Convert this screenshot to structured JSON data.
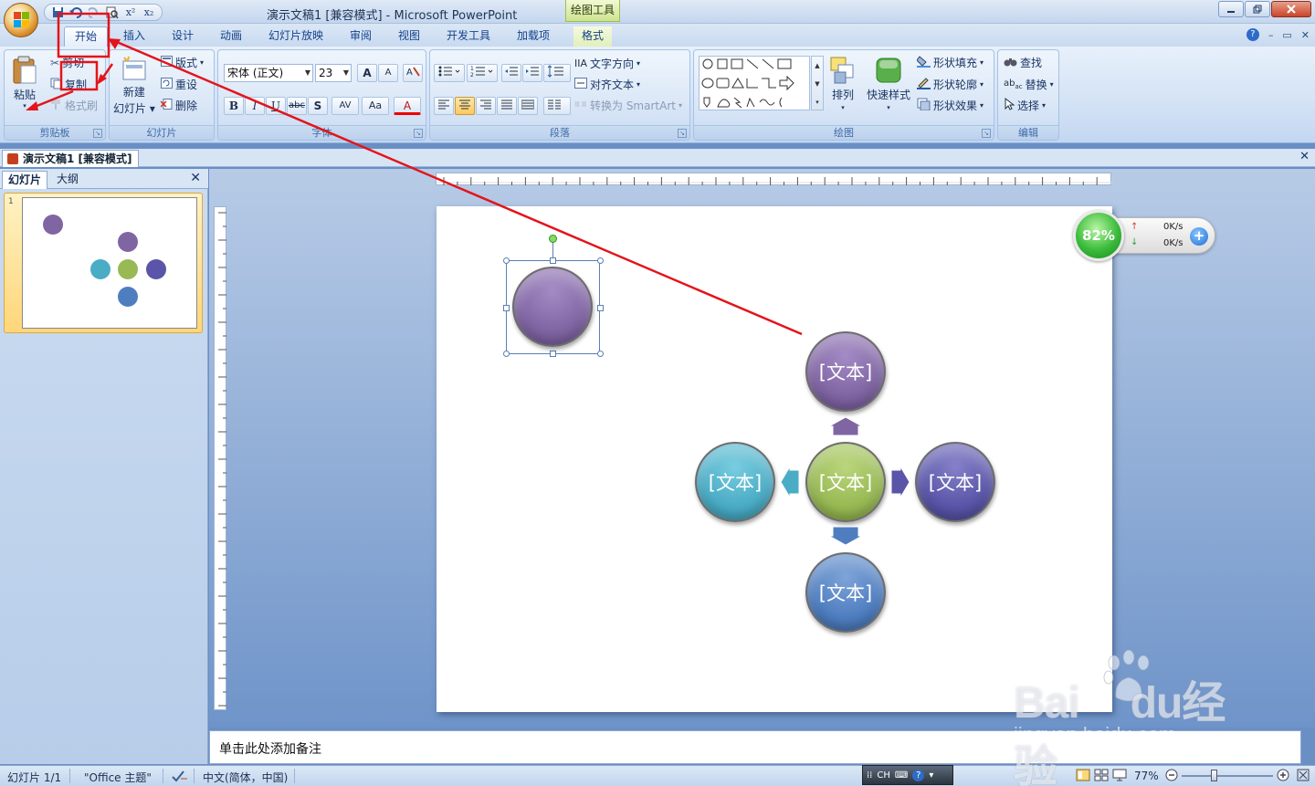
{
  "titlebar": {
    "title": "演示文稿1 [兼容模式] - Microsoft PowerPoint",
    "context_tab": "绘图工具",
    "qat": [
      "save-icon",
      "undo-icon",
      "redo-icon",
      "print-preview-icon",
      "superscript-icon",
      "subscript-icon"
    ],
    "qat_labels": {
      "superscript": "x²",
      "subscript": "x₂"
    }
  },
  "tabs": [
    {
      "label": "开始",
      "active": true
    },
    {
      "label": "插入"
    },
    {
      "label": "设计"
    },
    {
      "label": "动画"
    },
    {
      "label": "幻灯片放映"
    },
    {
      "label": "审阅"
    },
    {
      "label": "视图"
    },
    {
      "label": "开发工具"
    },
    {
      "label": "加载项"
    },
    {
      "label": "格式"
    }
  ],
  "ribbon": {
    "clipboard": {
      "paste": "粘贴",
      "cut": "剪切",
      "copy": "复制",
      "format_painter": "格式刷",
      "label": "剪贴板"
    },
    "slides": {
      "new_slide": "新建",
      "new_slide_2": "幻灯片",
      "layout": "版式",
      "reset": "重设",
      "delete": "删除",
      "label": "幻灯片"
    },
    "font": {
      "name": "宋体 (正文)",
      "size": "23",
      "label": "字体",
      "buttons": {
        "bold": "B",
        "italic": "I",
        "underline": "U",
        "strike": "abc",
        "shadow": "S",
        "spacing": "AV",
        "case": "Aa",
        "color": "A",
        "grow": "A",
        "shrink": "A"
      }
    },
    "paragraph": {
      "text_direction": "文字方向",
      "align_text": "对齐文本",
      "convert_smartart": "转换为 SmartArt",
      "label": "段落"
    },
    "drawing": {
      "arrange": "排列",
      "quick_styles": "快速样式",
      "fill": "形状填充",
      "outline": "形状轮廓",
      "effects": "形状效果",
      "label": "绘图"
    },
    "editing": {
      "find": "查找",
      "replace": "替换",
      "select": "选择",
      "label": "编辑"
    }
  },
  "doc_tab": "演示文稿1 [兼容模式]",
  "left_panel": {
    "tab_slides": "幻灯片",
    "tab_outline": "大纲",
    "slide_number": "1"
  },
  "slide": {
    "center_text": "[文本]",
    "top_text": "[文本]",
    "left_text": "[文本]",
    "right_text": "[文本]",
    "bottom_text": "[文本]"
  },
  "net_widget": {
    "percent": "82%",
    "up": "0K/s",
    "down": "0K/s"
  },
  "notes": {
    "placeholder": "单击此处添加备注"
  },
  "status": {
    "slide": "幻灯片 1/1",
    "theme": "\"Office 主题\"",
    "language": "中文(简体，中国)",
    "zoom": "77%",
    "ime": "CH"
  },
  "watermark": {
    "brand": "Bai",
    "brand2": "du",
    "site": "经验",
    "url": "jingyan.baidu.com"
  },
  "colors": {
    "purple": "#8065a3",
    "green": "#98b954",
    "teal": "#4aacc5",
    "indigo": "#5a55a8",
    "blue": "#4f7ec0",
    "annotation": "#e3141a"
  }
}
